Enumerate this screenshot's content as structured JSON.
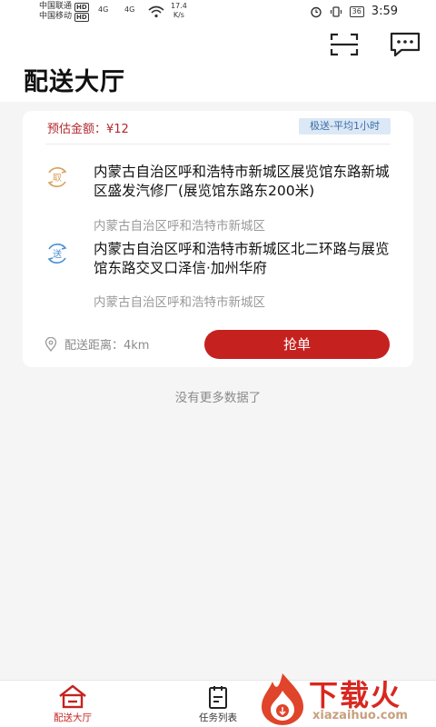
{
  "status_bar": {
    "carrier1": "中国联通",
    "carrier2": "中国移动",
    "hd": "HD",
    "signal1": "4G",
    "signal2": "4G",
    "speed_value": "17.4",
    "speed_unit": "K/s",
    "battery": "36",
    "time": "3:59"
  },
  "header": {
    "title": "配送大厅",
    "scan_icon": "scan-icon",
    "message_icon": "message-icon"
  },
  "order": {
    "price": "预估金额：¥12",
    "tag": "极送-平均1小时",
    "pickup": {
      "icon_label": "取",
      "address": "内蒙古自治区呼和浩特市新城区展览馆东路新城区盛发汽修厂(展览馆东路东200米)",
      "region": "内蒙古自治区呼和浩特市新城区"
    },
    "delivery": {
      "icon_label": "送",
      "address": "内蒙古自治区呼和浩特市新城区北二环路与展览馆东路交叉口泽信·加州华府",
      "region": "内蒙古自治区呼和浩特市新城区"
    },
    "distance": "配送距离：4km",
    "grab_button": "抢单"
  },
  "no_more": "没有更多数据了",
  "tabs": [
    {
      "label": "配送大厅",
      "icon": "home-icon",
      "active": true
    },
    {
      "label": "任务列表",
      "icon": "clipboard-icon",
      "active": false
    }
  ],
  "watermark": {
    "title": "下载火",
    "sub": "xiazaihuo.com"
  },
  "colors": {
    "accent": "#c5221f",
    "price": "#b3282d",
    "tag_bg": "#dce8f5",
    "tag_text": "#3a6ea8",
    "pickup_icon": "#d9a15a",
    "delivery_icon": "#4a8fd6"
  }
}
